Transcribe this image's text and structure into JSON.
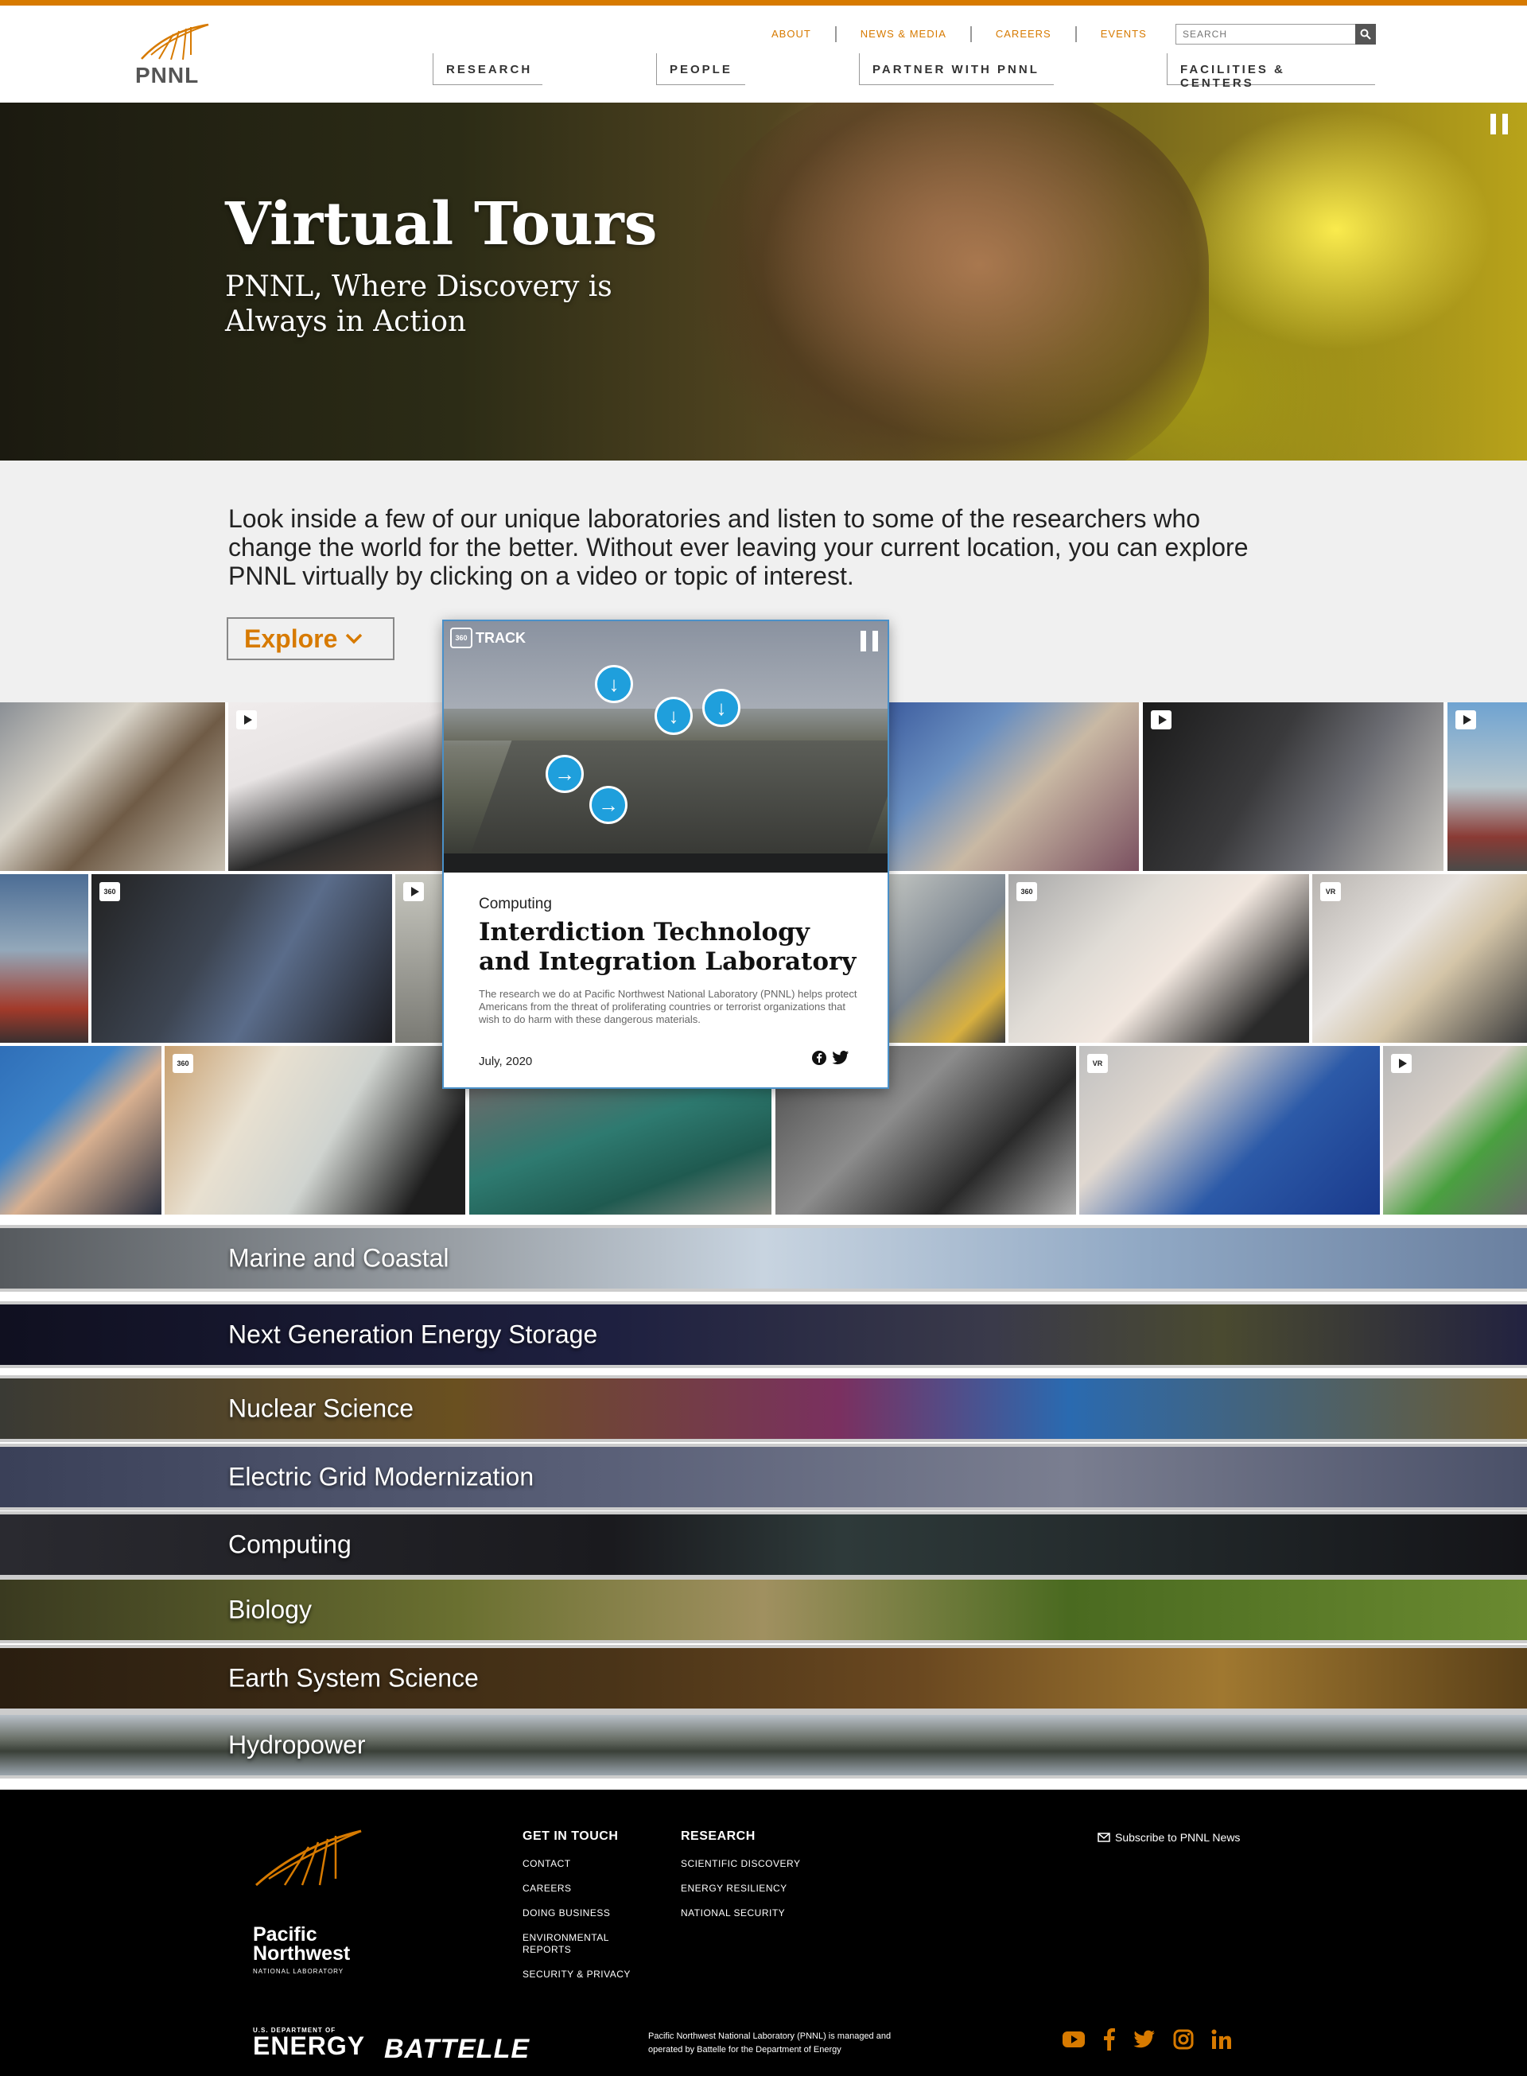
{
  "header": {
    "logo_text": "PNNL",
    "utility_nav": [
      "ABOUT",
      "NEWS & MEDIA",
      "CAREERS",
      "EVENTS"
    ],
    "search_placeholder": "SEARCH",
    "main_nav": [
      "RESEARCH",
      "PEOPLE",
      "PARTNER WITH PNNL",
      "FACILITIES & CENTERS"
    ]
  },
  "hero": {
    "title": "Virtual Tours",
    "subtitle": "PNNL, Where Discovery is Always in Action"
  },
  "intro": {
    "text": "Look inside a few of our unique laboratories and listen to some of the researchers who change the world for the better. Without ever leaving your current location, you can explore PNNL virtually by clicking on a video or topic of interest.",
    "explore_label": "Explore"
  },
  "tiles": {
    "badges": [
      "360",
      "360",
      "VR",
      "360",
      "VR"
    ]
  },
  "featured": {
    "video_logo": "TRACK",
    "video_badge": "360",
    "category": "Computing",
    "title": "Interdiction Technology and Integration Laboratory",
    "description": "The research we do at Pacific Northwest National Laboratory (PNNL) helps protect Americans from the threat of proliferating countries or terrorist organizations that wish to do harm with these dangerous materials.",
    "date": "July, 2020"
  },
  "topics": [
    "Marine and Coastal",
    "Next Generation Energy Storage",
    "Nuclear Science",
    "Electric Grid Modernization",
    "Computing",
    "Biology",
    "Earth System Science",
    "Hydropower"
  ],
  "footer": {
    "logo_lines": [
      "Pacific",
      "Northwest"
    ],
    "logo_sub": "NATIONAL LABORATORY",
    "get_in_touch": {
      "heading": "GET IN TOUCH",
      "links": [
        "CONTACT",
        "CAREERS",
        "DOING BUSINESS",
        "ENVIRONMENTAL REPORTS",
        "SECURITY & PRIVACY"
      ]
    },
    "research": {
      "heading": "RESEARCH",
      "links": [
        "SCIENTIFIC DISCOVERY",
        "ENERGY RESILIENCY",
        "NATIONAL SECURITY"
      ]
    },
    "subscribe": "Subscribe to PNNL News",
    "doe_small": "U.S. DEPARTMENT OF",
    "doe_big": "ENERGY",
    "battelle": "BATTELLE",
    "managed": "Pacific Northwest National Laboratory (PNNL) is managed and operated by Battelle for the Department of Energy"
  },
  "colors": {
    "accent": "#d77a00",
    "hotspot": "#1f9fdc",
    "footer_bg": "#000000"
  },
  "icons": [
    "search-icon",
    "pause-icon",
    "chevron-down-icon",
    "play-icon",
    "facebook-icon",
    "twitter-icon",
    "mail-icon",
    "youtube-icon",
    "instagram-icon",
    "linkedin-icon"
  ]
}
